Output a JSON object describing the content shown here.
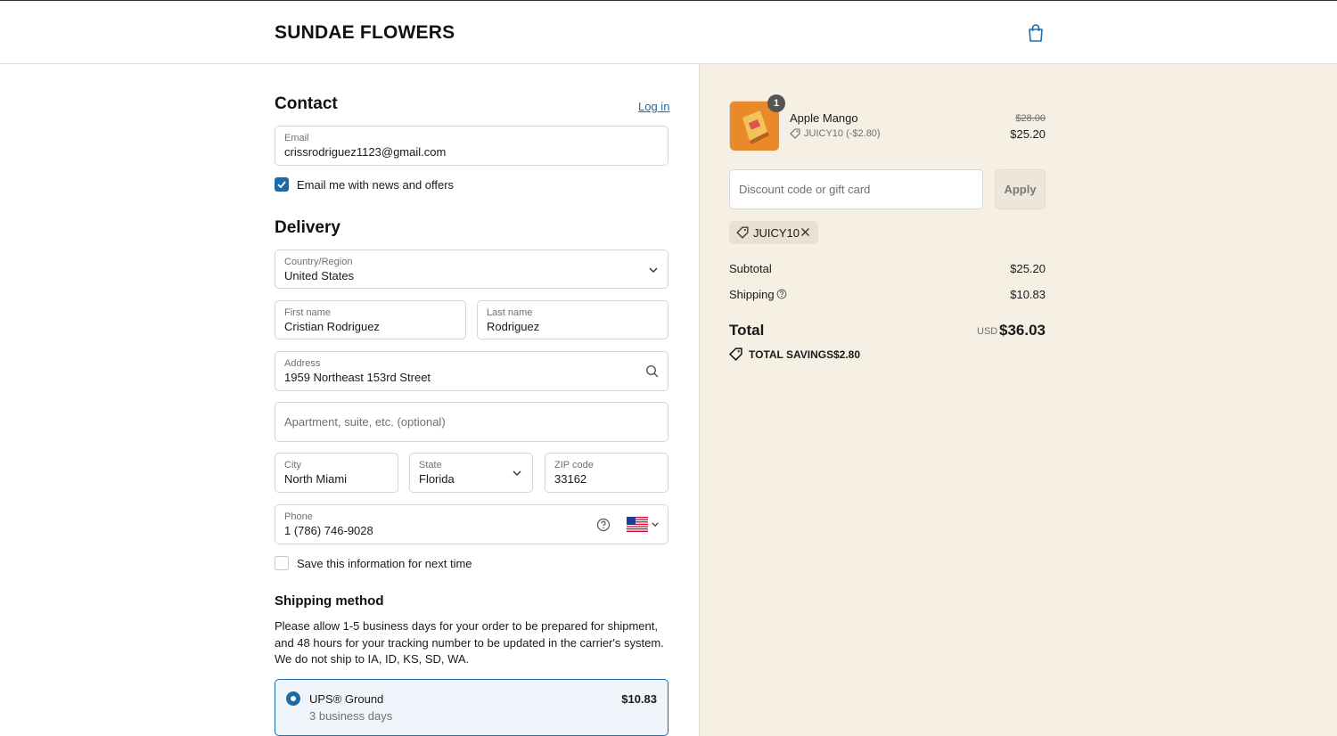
{
  "header": {
    "brand": "SUNDAE FLOWERS",
    "cart_icon": "shopping-bag-icon"
  },
  "contact": {
    "heading": "Contact",
    "login_link": "Log in",
    "email_label": "Email",
    "email_value": "crissrodriguez1123@gmail.com",
    "newsletter_label": "Email me with news and offers",
    "newsletter_checked": true
  },
  "delivery": {
    "heading": "Delivery",
    "country_label": "Country/Region",
    "country_value": "United States",
    "first_name_label": "First name",
    "first_name_value": "Cristian Rodriguez",
    "last_name_label": "Last name",
    "last_name_value": "Rodriguez",
    "address_label": "Address",
    "address_value": "1959 Northeast 153rd Street",
    "apartment_placeholder": "Apartment, suite, etc. (optional)",
    "city_label": "City",
    "city_value": "North Miami",
    "state_label": "State",
    "state_value": "Florida",
    "zip_label": "ZIP code",
    "zip_value": "33162",
    "phone_label": "Phone",
    "phone_value": "1 (786) 746-9028",
    "save_info_label": "Save this information for next time",
    "save_info_checked": false
  },
  "shipping": {
    "heading": "Shipping method",
    "note": "Please allow 1-5 business days for your order to be prepared for shipment, and 48 hours for your tracking number to be updated in the carrier's system. We do not ship to IA, ID, KS, SD, WA.",
    "option_name": "UPS® Ground",
    "option_eta": "3 business days",
    "option_price": "$10.83"
  },
  "summary": {
    "item_name": "Apple Mango",
    "item_quantity": "1",
    "item_discount": "JUICY10 (-$2.80)",
    "item_original_price": "$28.00",
    "item_price": "$25.20",
    "discount_placeholder": "Discount code or gift card",
    "apply_label": "Apply",
    "applied_code": "JUICY10",
    "subtotal_label": "Subtotal",
    "subtotal_value": "$25.20",
    "shipping_label": "Shipping",
    "shipping_value": "$10.83",
    "total_label": "Total",
    "total_currency": "USD",
    "total_value": "$36.03",
    "savings_label": "TOTAL SAVINGS",
    "savings_value": "$2.80"
  },
  "colors": {
    "accent": "#1b6bab",
    "summary_bg": "#f5efe4"
  }
}
